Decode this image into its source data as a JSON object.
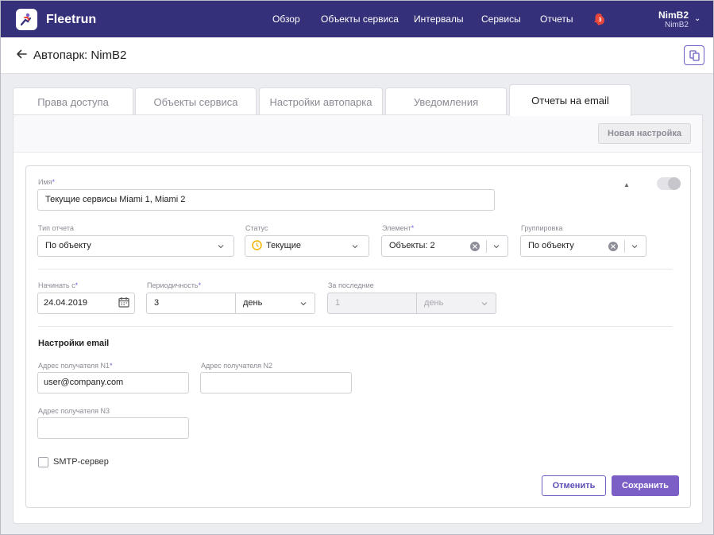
{
  "header": {
    "brand": "Fleetrun",
    "nav": [
      "Обзор",
      "Объекты сервиса",
      "Интервалы",
      "Сервисы",
      "Отчеты"
    ],
    "notifications_count": "3",
    "user_name": "NimB2",
    "user_account": "NimB2"
  },
  "page": {
    "title": "Автопарк: NimB2"
  },
  "tabs": [
    {
      "label": "Права доступа",
      "active": false
    },
    {
      "label": "Объекты сервиса",
      "active": false
    },
    {
      "label": "Настройки автопарка",
      "active": false
    },
    {
      "label": "Уведомления",
      "active": false
    },
    {
      "label": "Отчеты на email",
      "active": true
    }
  ],
  "toolbar": {
    "new_setting_label": "Новая настройка"
  },
  "form": {
    "name_label": "Имя",
    "name_value": "Текущие сервисы Miami 1, Miami 2",
    "report_type_label": "Тип отчета",
    "report_type_value": "По объекту",
    "status_label": "Статус",
    "status_value": "Текущие",
    "element_label": "Элемент",
    "element_value": "Объекты: 2",
    "grouping_label": "Группировка",
    "grouping_value": "По объекту",
    "start_label": "Начинать с",
    "start_value": "24.04.2019",
    "period_label": "Периодичность",
    "period_value": "3",
    "period_unit": "день",
    "last_label": "За последние",
    "last_value": "1",
    "last_unit": "день",
    "email_section_title": "Настройки email",
    "recipient1_label": "Адрес получателя N1",
    "recipient1_value": "user@company.com",
    "recipient2_label": "Адрес получателя N2",
    "recipient2_value": "",
    "recipient3_label": "Адрес получателя N3",
    "recipient3_value": "",
    "smtp_label": "SMTP-сервер",
    "smtp_checked": false,
    "enabled": false,
    "required_mark": "*",
    "cancel_label": "Отменить",
    "save_label": "Сохранить"
  },
  "colors": {
    "header_bg": "#35307a",
    "accent": "#7b5fc6",
    "badge": "#e8463b",
    "status_clock": "#f0b400"
  }
}
